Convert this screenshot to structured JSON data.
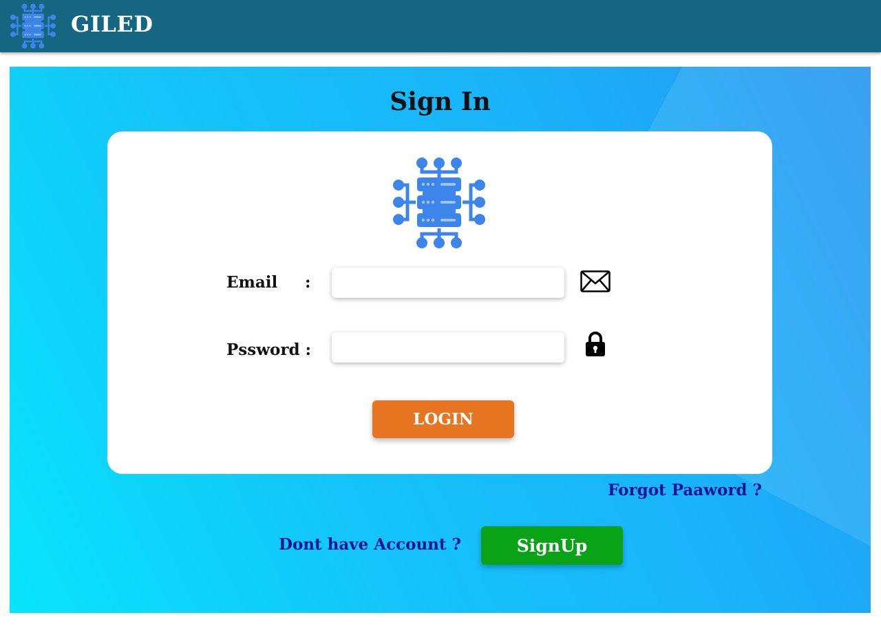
{
  "header": {
    "app_name": "GILED",
    "background_color": "#156680",
    "logo_icon": "server-network-icon"
  },
  "signin": {
    "title": "Sign In",
    "logo_icon": "server-network-icon",
    "logo_color": "#3d85ea",
    "email": {
      "label": "Email",
      "colon": ":",
      "value": "",
      "placeholder": "",
      "icon": "envelope-icon"
    },
    "password": {
      "label": "Pssword :",
      "value": "",
      "placeholder": "",
      "icon": "lock-icon"
    },
    "login_label": "LOGIN",
    "login_color": "#e87522",
    "forgot_label": "Forgot Paaword ?",
    "no_account_label": "Dont have Account ?",
    "signup_label": "SignUp",
    "signup_color": "#0aa317",
    "link_color": "#0d1596"
  }
}
